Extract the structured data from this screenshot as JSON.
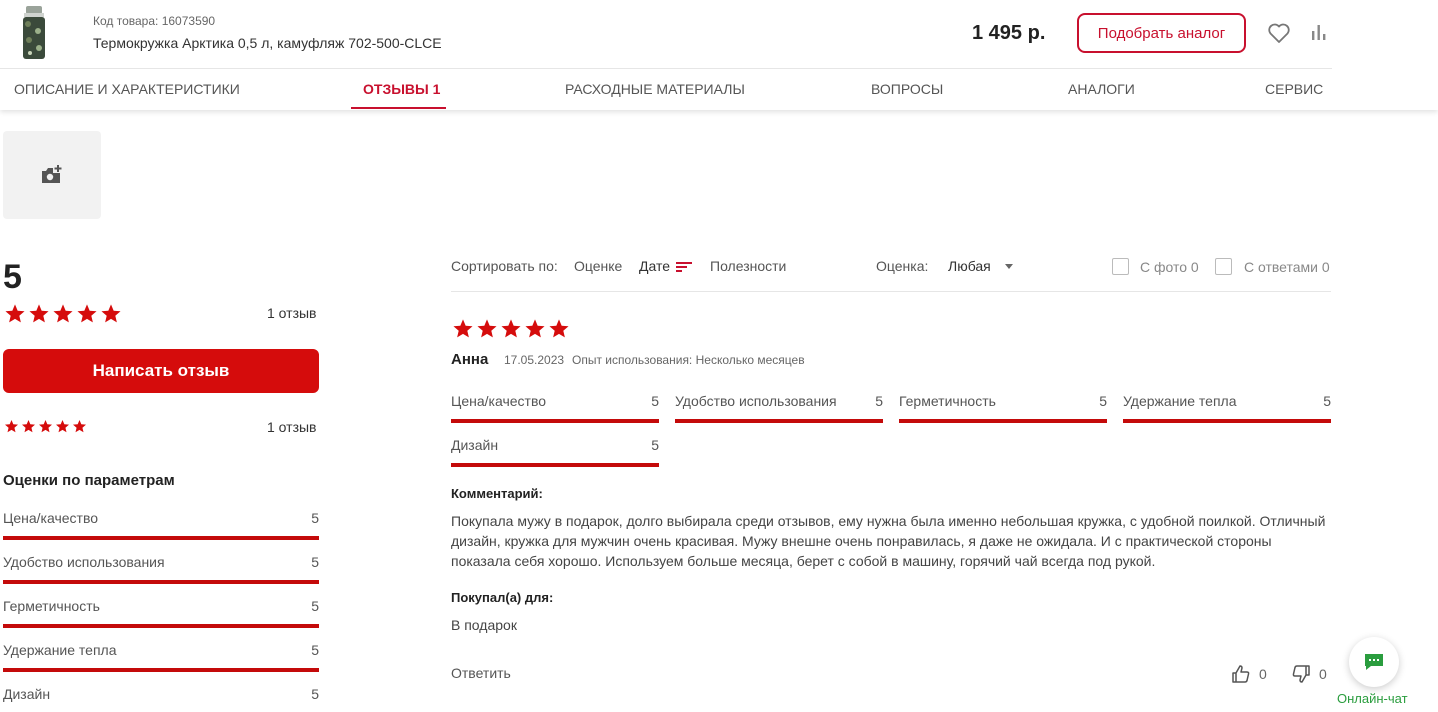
{
  "header": {
    "product_code": "Код товара: 16073590",
    "product_name": "Термокружка Арктика 0,5 л, камуфляж 702-500-CLCE",
    "price": "1 495 р.",
    "analog_button": "Подобрать аналог",
    "favorite_icon": "heart-icon",
    "compare_icon": "bar-chart-icon"
  },
  "tabs": [
    {
      "label": "ОПИСАНИЕ И ХАРАКТЕРИСТИКИ",
      "active": false
    },
    {
      "label": "ОТЗЫВЫ 1",
      "active": true
    },
    {
      "label": "РАСХОДНЫЕ МАТЕРИАЛЫ",
      "active": false
    },
    {
      "label": "ВОПРОСЫ",
      "active": false
    },
    {
      "label": "АНАЛОГИ",
      "active": false
    },
    {
      "label": "СЕРВИС",
      "active": false
    }
  ],
  "photo_upload": {
    "icon": "camera-add-icon"
  },
  "summary": {
    "average": "5",
    "stars": 5,
    "count_label": "1 отзыв",
    "write_button": "Написать отзыв",
    "breakdown": [
      {
        "stars": 5,
        "count_label": "1 отзыв"
      }
    ],
    "params_title": "Оценки по параметрам",
    "params": [
      {
        "name": "Цена/качество",
        "value": "5",
        "fraction": 1.0
      },
      {
        "name": "Удобство использования",
        "value": "5",
        "fraction": 1.0
      },
      {
        "name": "Герметичность",
        "value": "5",
        "fraction": 1.0
      },
      {
        "name": "Удержание тепла",
        "value": "5",
        "fraction": 1.0
      },
      {
        "name": "Дизайн",
        "value": "5",
        "fraction": 1.0
      }
    ]
  },
  "toolbar": {
    "sort_label": "Сортировать по:",
    "sort_options": [
      "Оценке",
      "Дате",
      "Полезности"
    ],
    "sort_active": "Дате",
    "rating_label": "Оценка:",
    "rating_value": "Любая",
    "with_photo": "С фото 0",
    "with_answers": "С ответами 0"
  },
  "review": {
    "stars": 5,
    "author": "Анна",
    "date": "17.05.2023",
    "experience": "Опыт использования: Несколько месяцев",
    "params": [
      {
        "name": "Цена/качество",
        "value": "5",
        "fraction": 1.0
      },
      {
        "name": "Удобство использования",
        "value": "5",
        "fraction": 1.0
      },
      {
        "name": "Герметичность",
        "value": "5",
        "fraction": 1.0
      },
      {
        "name": "Удержание тепла",
        "value": "5",
        "fraction": 1.0
      },
      {
        "name": "Дизайн",
        "value": "5",
        "fraction": 1.0
      }
    ],
    "comment_heading": "Комментарий:",
    "comment": "Покупала мужу в подарок, долго выбирала среди отзывов, ему нужна была именно небольшая кружка, с удобной поилкой. Отличный дизайн, кружка для мужчин очень красивая. Мужу внешне очень понравилась, я даже не ожидала. И с практической стороны показала себя хорошо. Используем больше месяца, берет с собой в машину, горячий чай всегда под рукой.",
    "bought_for_heading": "Покупал(а) для:",
    "bought_for": "В подарок",
    "reply": "Ответить",
    "likes": "0",
    "dislikes": "0"
  },
  "chat": {
    "label": "Онлайн-чат",
    "icon": "chat-bubble-icon"
  },
  "colors": {
    "accent": "#c8102e",
    "button_red": "#d50c0c",
    "star": "#d50c0c",
    "chat_green": "#2a9d3e"
  }
}
